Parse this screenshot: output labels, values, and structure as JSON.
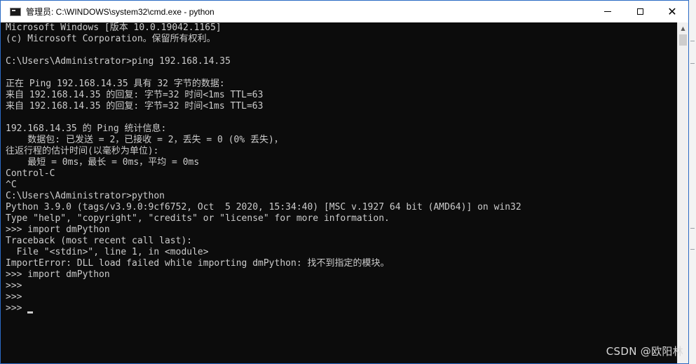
{
  "window": {
    "title": "管理员: C:\\WINDOWS\\system32\\cmd.exe - python",
    "minimize_icon": "minimize-icon",
    "maximize_icon": "maximize-icon",
    "close_glyph": "✕"
  },
  "console": {
    "lines": [
      "Microsoft Windows [版本 10.0.19042.1165]",
      "(c) Microsoft Corporation。保留所有权利。",
      "",
      "C:\\Users\\Administrator>ping 192.168.14.35",
      "",
      "正在 Ping 192.168.14.35 具有 32 字节的数据:",
      "来自 192.168.14.35 的回复: 字节=32 时间<1ms TTL=63",
      "来自 192.168.14.35 的回复: 字节=32 时间<1ms TTL=63",
      "",
      "192.168.14.35 的 Ping 统计信息:",
      "    数据包: 已发送 = 2，已接收 = 2，丢失 = 0 (0% 丢失)，",
      "往返行程的估计时间(以毫秒为单位):",
      "    最短 = 0ms，最长 = 0ms，平均 = 0ms",
      "Control-C",
      "^C",
      "C:\\Users\\Administrator>python",
      "Python 3.9.0 (tags/v3.9.0:9cf6752, Oct  5 2020, 15:34:40) [MSC v.1927 64 bit (AMD64)] on win32",
      "Type \"help\", \"copyright\", \"credits\" or \"license\" for more information.",
      ">>> import dmPython",
      "Traceback (most recent call last):",
      "  File \"<stdin>\", line 1, in <module>",
      "ImportError: DLL load failed while importing dmPython: 找不到指定的模块。",
      ">>> import dmPython",
      ">>>",
      ">>>",
      ">>> "
    ]
  },
  "watermark": "CSDN @欧阳林",
  "colors": {
    "console_bg": "#0c0c0c",
    "console_fg": "#cccccc",
    "window_border": "#2a6ac4"
  }
}
